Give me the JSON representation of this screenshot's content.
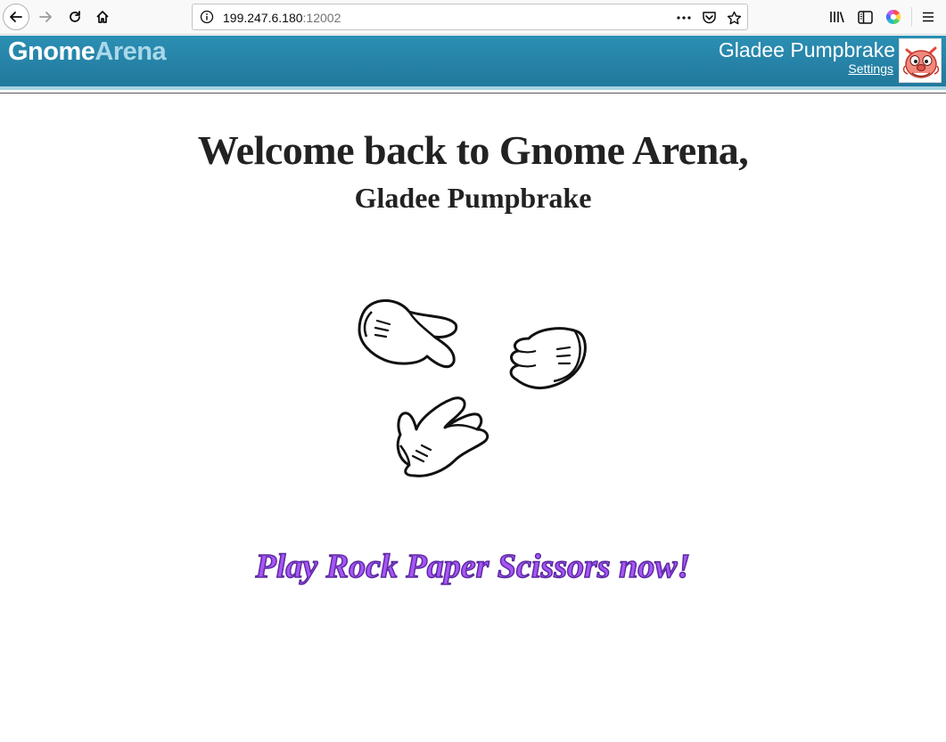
{
  "browser": {
    "url_host": "199.247.6.180",
    "url_port": ":12002",
    "icons": [
      "back-icon",
      "forward-icon",
      "reload-icon",
      "home-icon",
      "info-icon",
      "more-icon",
      "pocket-icon",
      "bookmark-star-icon",
      "library-icon",
      "sidebar-icon",
      "color-wheel-icon",
      "hamburger-menu-icon"
    ]
  },
  "header": {
    "logo_part1": "Gnome",
    "logo_part2": "Arena",
    "user_name": "Gladee Pumpbrake",
    "settings_label": "Settings",
    "bar_color": "#2688ad",
    "logo_accent": "#a9d8ea"
  },
  "main": {
    "welcome": "Welcome back to Gnome Arena,",
    "user_name": "Gladee Pumpbrake",
    "play_label": "Play Rock Paper Scissors now!",
    "play_color": "#a855f7"
  }
}
